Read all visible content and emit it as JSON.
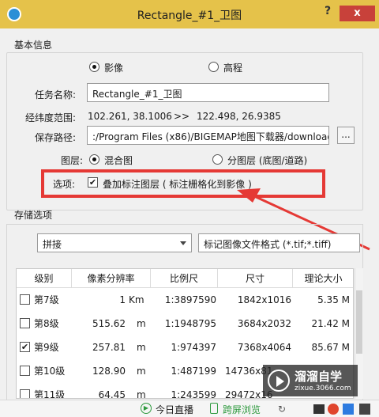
{
  "window": {
    "title": "Rectangle_#1_卫图",
    "help": "?",
    "close": "x"
  },
  "basic_info": {
    "section_label": "基本信息",
    "mode_options": [
      {
        "label": "影像",
        "selected": true
      },
      {
        "label": "高程",
        "selected": false
      }
    ],
    "task_name_label": "任务名称:",
    "task_name_value": "Rectangle_#1_卫图",
    "range_label": "经纬度范围:",
    "range_start": "102.261, 38.1006",
    "range_arrow": ">>",
    "range_end": "122.498, 26.9385",
    "save_path_label": "保存路径:",
    "save_path_value": ":/Program Files (x86)/BIGEMAP地图下载器/download",
    "browse_label": "...",
    "layer_label": "图层:",
    "layer_options": [
      {
        "label": "混合图",
        "selected": true
      },
      {
        "label": "分图层 (底图/道路)",
        "selected": false
      }
    ],
    "options_label": "选项:",
    "overlay_checkbox_label": "叠加标注图层 ( 标注栅格化到影像 )",
    "overlay_checked": true
  },
  "storage": {
    "section_label": "存储选项",
    "stitch_select": "拼接",
    "format_select": "标记图像文件格式 (*.tif;*.tiff)"
  },
  "table": {
    "headers": [
      "级别",
      "像素分辨率",
      "比例尺",
      "尺寸",
      "理论大小"
    ],
    "rows": [
      {
        "checked": false,
        "level": "第7级",
        "res_val": "1",
        "res_unit": "Km",
        "scale": "1:3897590",
        "size": "1842x1016",
        "theory": "5.35 M"
      },
      {
        "checked": false,
        "level": "第8级",
        "res_val": "515.62",
        "res_unit": "m",
        "scale": "1:1948795",
        "size": "3684x2032",
        "theory": "21.42 M"
      },
      {
        "checked": true,
        "level": "第9级",
        "res_val": "257.81",
        "res_unit": "m",
        "scale": "1:974397",
        "size": "7368x4064",
        "theory": "85.67 M"
      },
      {
        "checked": false,
        "level": "第10级",
        "res_val": "128.90",
        "res_unit": "m",
        "scale": "1:487199",
        "size": "14736x81",
        "theory": ""
      },
      {
        "checked": false,
        "level": "第11级",
        "res_val": "64.45",
        "res_unit": "m",
        "scale": "1:243599",
        "size": "29472x16",
        "theory": ""
      }
    ]
  },
  "statusbar": {
    "item1": "今日直播",
    "item2": "跨屏浏览"
  },
  "watermark": {
    "title": "溜溜自学",
    "url": "zixue.3066.com"
  },
  "colors": {
    "titlebar": "#e5c24a",
    "close": "#c8413a",
    "highlight": "#e53935"
  }
}
